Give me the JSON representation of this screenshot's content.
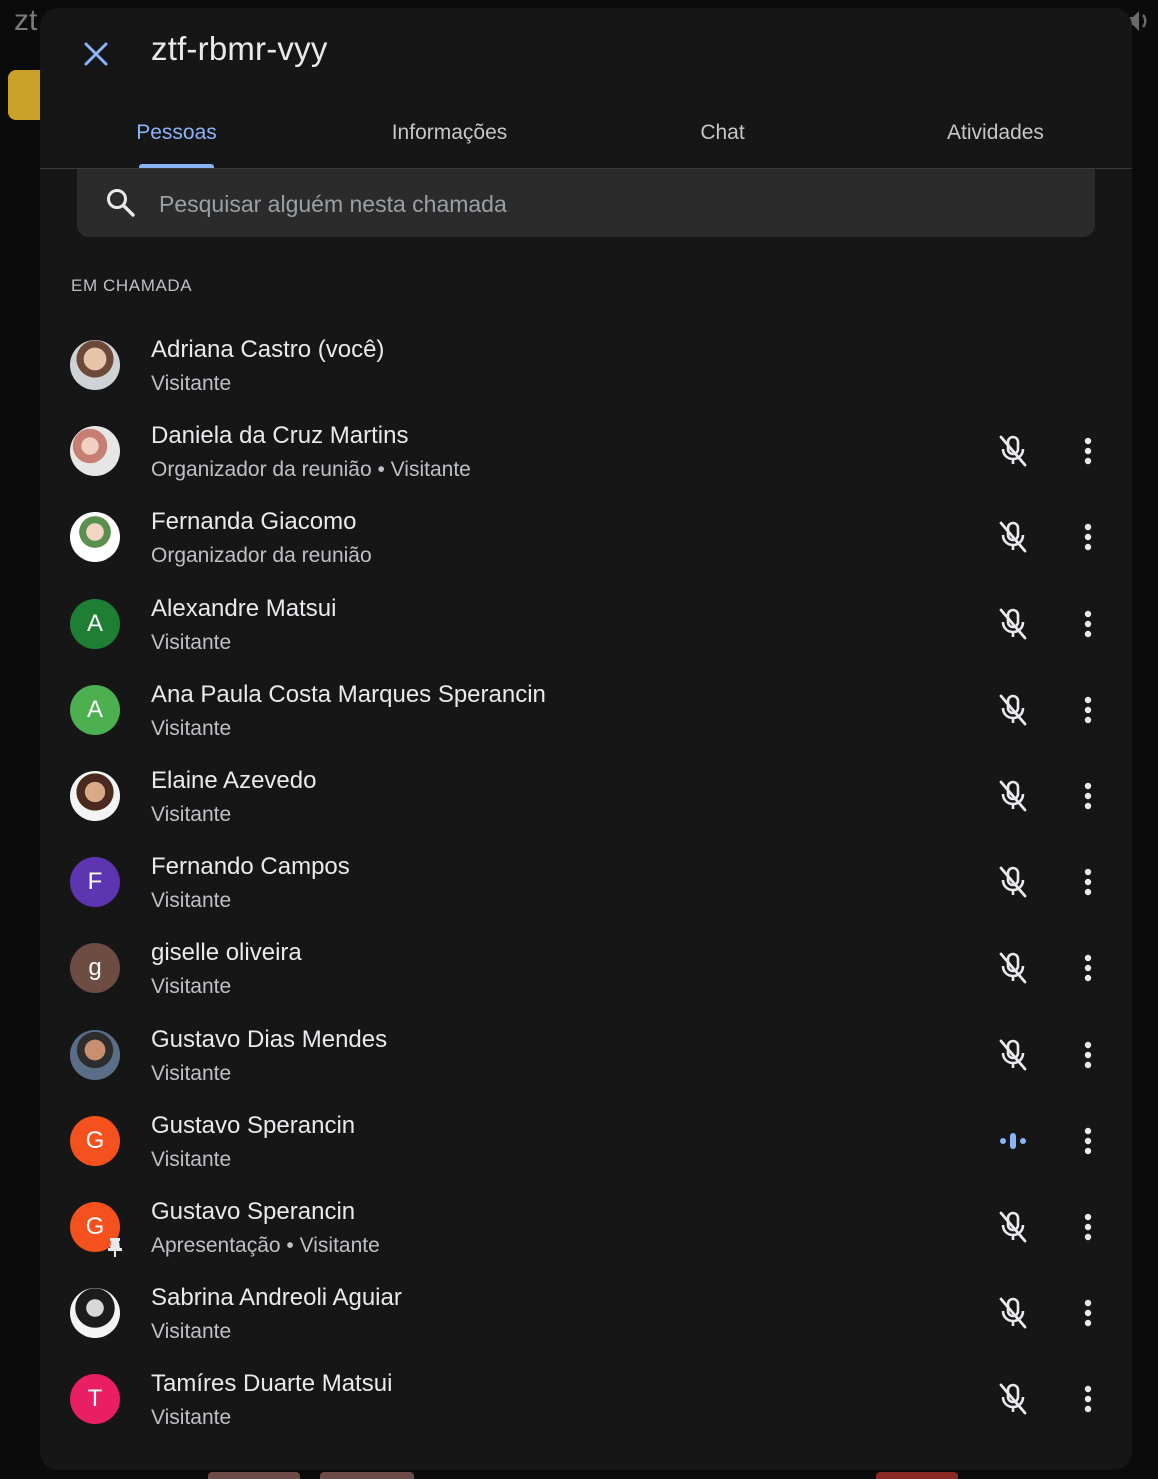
{
  "background": {
    "title_fragment": "zt"
  },
  "header": {
    "close_icon": "close-icon",
    "meeting_code": "ztf-rbmr-vyy"
  },
  "tabs": [
    {
      "label": "Pessoas",
      "active": true
    },
    {
      "label": "Informações",
      "active": false
    },
    {
      "label": "Chat",
      "active": false
    },
    {
      "label": "Atividades",
      "active": false
    }
  ],
  "search": {
    "placeholder": "Pesquisar alguém nesta chamada"
  },
  "section": {
    "label": "EM CHAMADA"
  },
  "participants": [
    {
      "name": "Adriana Castro (você)",
      "role": "Visitante",
      "avatar": "photo",
      "status": "none"
    },
    {
      "name": "Daniela da Cruz Martins",
      "role": "Organizador da reunião • Visitante",
      "avatar": "photo",
      "status": "muted"
    },
    {
      "name": "Fernanda Giacomo",
      "role": "Organizador da reunião",
      "avatar": "photo",
      "status": "muted"
    },
    {
      "name": "Alexandre Matsui",
      "role": "Visitante",
      "avatar_letter": "A",
      "avatar_color": "#1e7e34",
      "status": "muted"
    },
    {
      "name": "Ana Paula Costa Marques Sperancin",
      "role": "Visitante",
      "avatar_letter": "A",
      "avatar_color": "#4caf50",
      "status": "muted"
    },
    {
      "name": "Elaine Azevedo",
      "role": "Visitante",
      "avatar": "photo",
      "status": "muted"
    },
    {
      "name": "Fernando Campos",
      "role": "Visitante",
      "avatar_letter": "F",
      "avatar_color": "#5e35b1",
      "status": "muted"
    },
    {
      "name": "giselle oliveira",
      "role": "Visitante",
      "avatar_letter": "g",
      "avatar_color": "#6d4c41",
      "status": "muted"
    },
    {
      "name": "Gustavo Dias Mendes",
      "role": "Visitante",
      "avatar": "photo",
      "status": "muted"
    },
    {
      "name": "Gustavo Sperancin",
      "role": "Visitante",
      "avatar_letter": "G",
      "avatar_color": "#f4511e",
      "status": "speaking"
    },
    {
      "name": "Gustavo Sperancin",
      "role": "Apresentação • Visitante",
      "avatar_letter": "G",
      "avatar_color": "#f4511e",
      "status": "muted",
      "pinned": true
    },
    {
      "name": "Sabrina Andreoli Aguiar",
      "role": "Visitante",
      "avatar": "photo",
      "status": "muted"
    },
    {
      "name": "Tamíres Duarte Matsui",
      "role": "Visitante",
      "avatar_letter": "T",
      "avatar_color": "#e91e63",
      "status": "muted"
    }
  ],
  "colors": {
    "accent": "#8ab4f8",
    "panel": "#161616",
    "search_bg": "#2b2b2b"
  }
}
